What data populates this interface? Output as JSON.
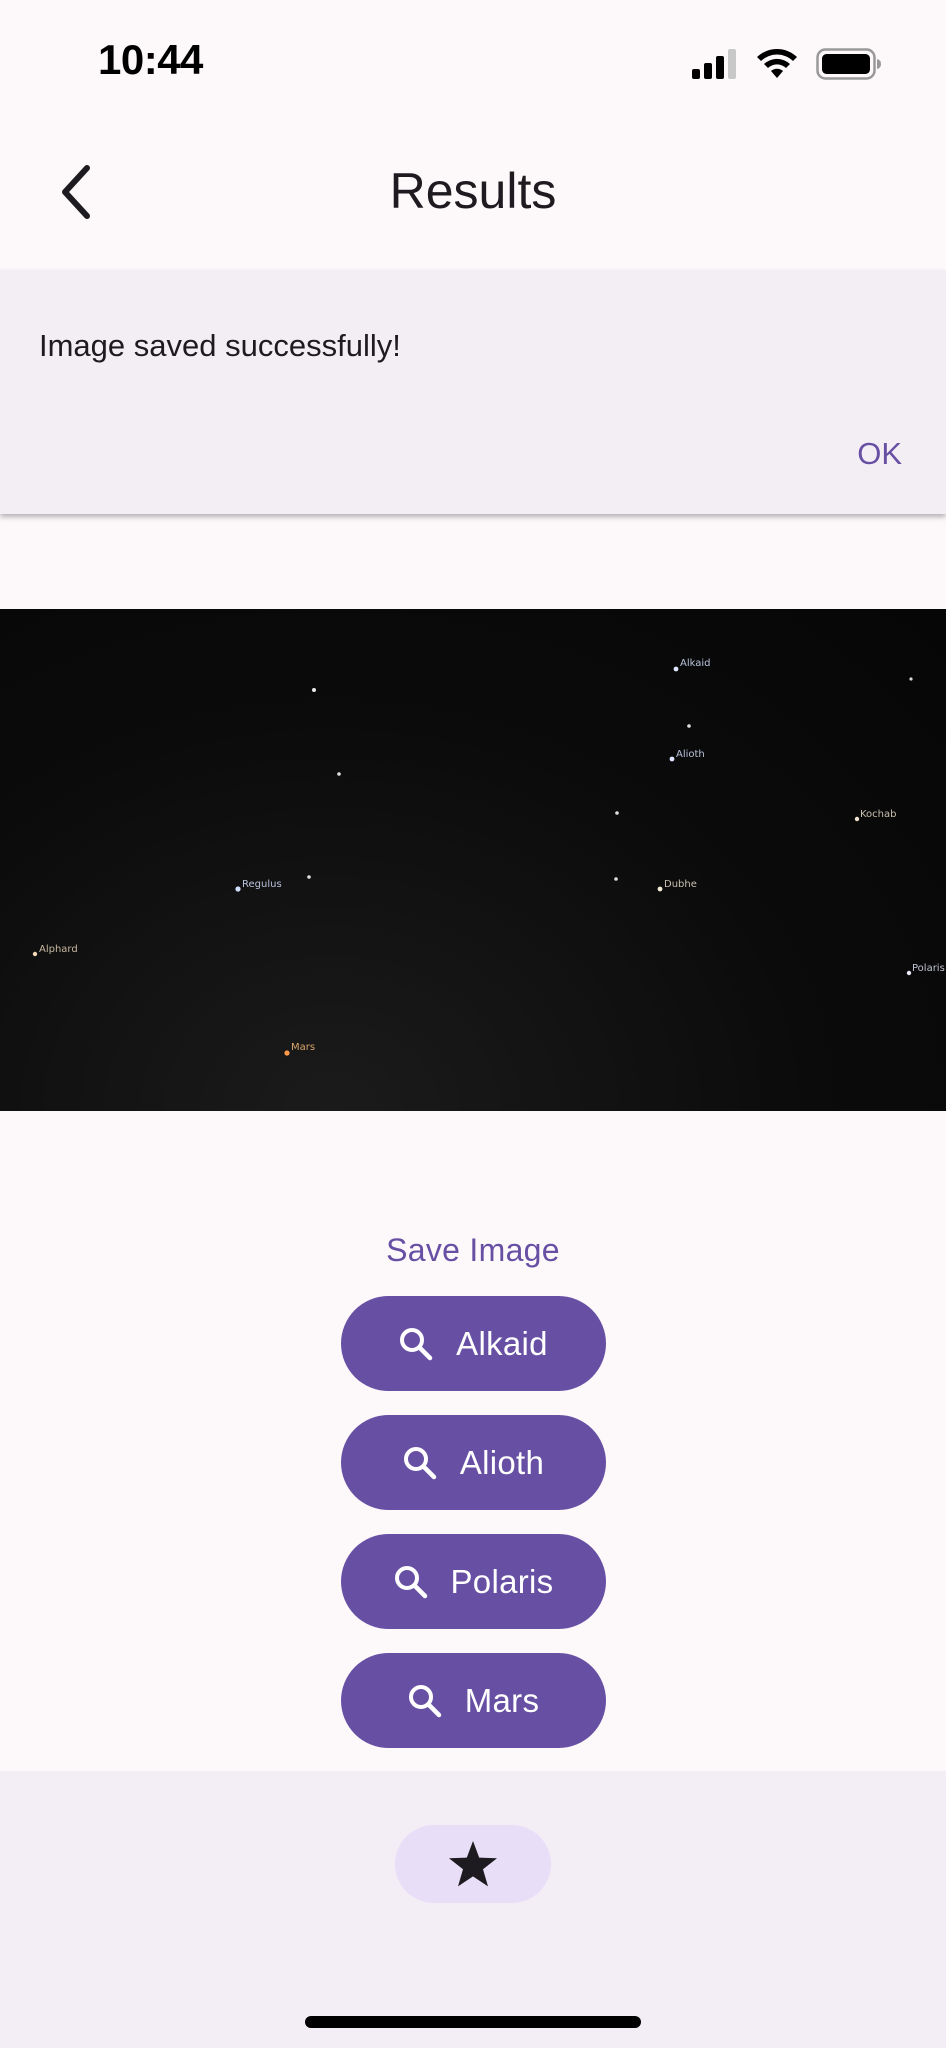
{
  "status_bar": {
    "time": "10:44"
  },
  "app_bar": {
    "title": "Results"
  },
  "snackbar": {
    "message": "Image saved successfully!",
    "action_label": "OK"
  },
  "sky_labels": {
    "alkaid": "Alkaid",
    "alioth": "Alioth",
    "kochab": "Kochab",
    "regulus": "Regulus",
    "dubhe": "Dubhe",
    "alphard": "Alphard",
    "polaris": "Polaris",
    "mars": "Mars"
  },
  "actions": {
    "save_label": "Save Image",
    "star_buttons": [
      {
        "label": "Alkaid",
        "icon": "search-icon"
      },
      {
        "label": "Alioth",
        "icon": "search-icon"
      },
      {
        "label": "Polaris",
        "icon": "search-icon"
      },
      {
        "label": "Mars",
        "icon": "search-icon"
      }
    ]
  },
  "bottom_nav": {
    "icon": "star-icon"
  },
  "colors": {
    "primary": "#6750a4",
    "surface": "#fdf8fa",
    "snackbar_bg": "#f3eef4",
    "nav_pill": "#e8def8",
    "mars_label": "#d9a56a",
    "star_label": "#b9c4dc"
  }
}
